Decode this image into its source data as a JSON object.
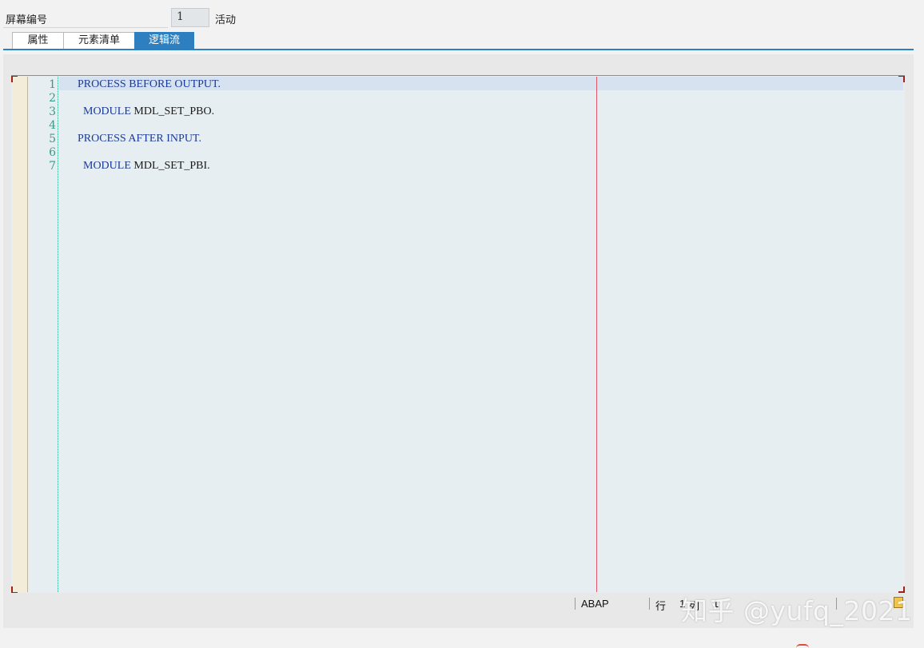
{
  "header": {
    "screen_number_label": "屏幕编号",
    "screen_number_value": "1",
    "status": "活动"
  },
  "tabs": [
    {
      "label": "属性",
      "active": false
    },
    {
      "label": "元素清单",
      "active": false
    },
    {
      "label": "逻辑流",
      "active": true
    }
  ],
  "editor": {
    "lines": [
      {
        "number": "1",
        "keyword": "PROCESS BEFORE OUTPUT.",
        "rest": ""
      },
      {
        "number": "2",
        "keyword": "",
        "rest": ""
      },
      {
        "number": "3",
        "keyword": "  MODULE",
        "rest": " MDL_SET_PBO."
      },
      {
        "number": "4",
        "keyword": "",
        "rest": ""
      },
      {
        "number": "5",
        "keyword": "PROCESS AFTER INPUT.",
        "rest": ""
      },
      {
        "number": "6",
        "keyword": "",
        "rest": ""
      },
      {
        "number": "7",
        "keyword": "  MODULE",
        "rest": " MDL_SET_PBI."
      }
    ]
  },
  "statusbar": {
    "language": "ABAP",
    "line_label": "行",
    "line_value": "1",
    "col_label": "列",
    "col_value": "1"
  },
  "watermark": "知乎 @yufq_2021",
  "colors": {
    "accent": "#2d7fbf",
    "keyword": "#1a3a9a",
    "line_numbers": "#3a9a8a",
    "margin_line": "#e0566a"
  }
}
